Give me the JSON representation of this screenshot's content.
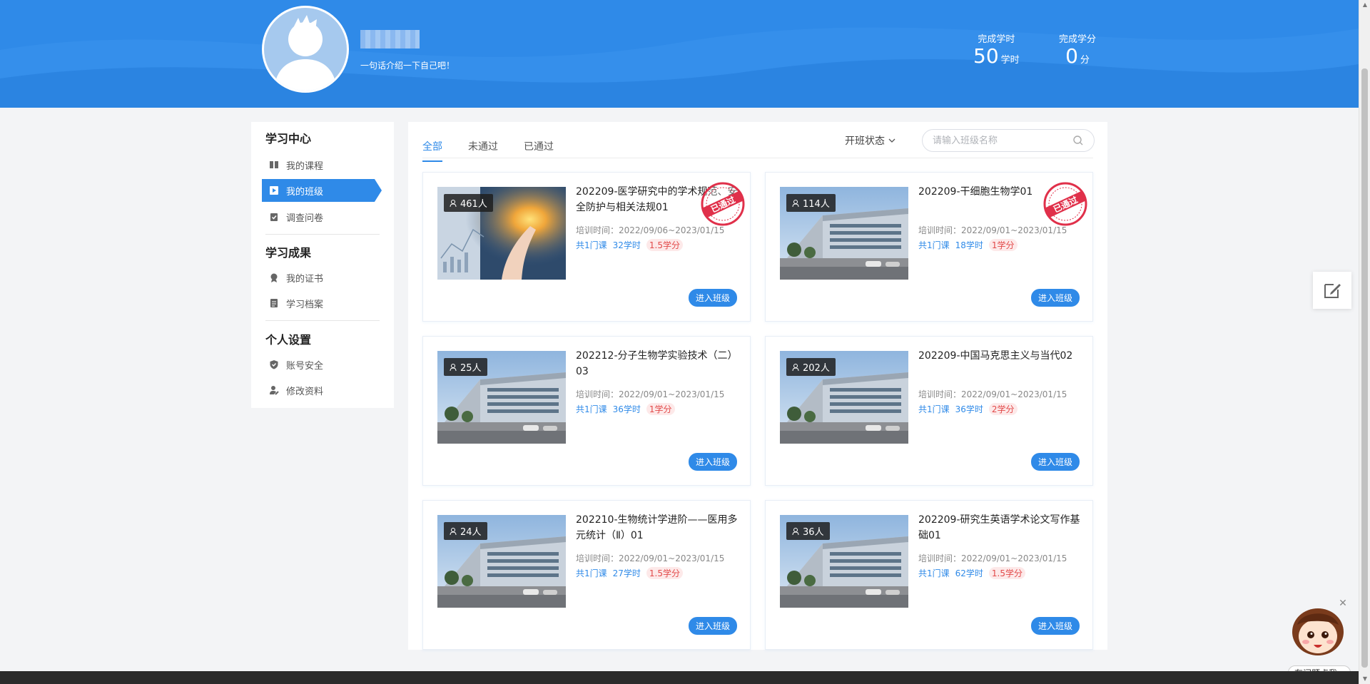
{
  "header": {
    "bio": "一句话介绍一下自己吧！",
    "stats": [
      {
        "label": "完成学时",
        "value": "50",
        "unit": "学时"
      },
      {
        "label": "完成学分",
        "value": "0",
        "unit": "分"
      }
    ],
    "background_color": "#2f8ae8"
  },
  "sidebar": {
    "sections": [
      {
        "title": "学习中心",
        "items": [
          {
            "label": "我的课程",
            "icon": "book-icon",
            "active": false
          },
          {
            "label": "我的班级",
            "icon": "class-icon",
            "active": true
          },
          {
            "label": "调查问卷",
            "icon": "clipboard-icon",
            "active": false
          }
        ]
      },
      {
        "title": "学习成果",
        "items": [
          {
            "label": "我的证书",
            "icon": "certificate-icon",
            "active": false
          },
          {
            "label": "学习档案",
            "icon": "file-icon",
            "active": false
          }
        ]
      },
      {
        "title": "个人设置",
        "items": [
          {
            "label": "账号安全",
            "icon": "shield-icon",
            "active": false
          },
          {
            "label": "修改资料",
            "icon": "user-edit-icon",
            "active": false
          }
        ]
      }
    ]
  },
  "main": {
    "tabs": [
      {
        "label": "全部",
        "active": true
      },
      {
        "label": "未通过",
        "active": false
      },
      {
        "label": "已通过",
        "active": false
      }
    ],
    "filter_label": "开班状态",
    "search_placeholder": "请输入班级名称",
    "enter_label": "进入班级",
    "stamp_text": "已通过",
    "cards": [
      {
        "count": "461人",
        "title": "202209-医学研究中的学术规范、安全防护与相关法规01",
        "time": "培训时间：2022/09/06~2023/01/15",
        "courses": "共1门课",
        "hours": "32学时",
        "credits": "1.5学分",
        "passed": true,
        "image": "tech"
      },
      {
        "count": "114人",
        "title": "202209-干细胞生物学01",
        "time": "培训时间：2022/09/01~2023/01/15",
        "courses": "共1门课",
        "hours": "18学时",
        "credits": "1学分",
        "passed": true,
        "image": "building"
      },
      {
        "count": "25人",
        "title": "202212-分子生物学实验技术（二）03",
        "time": "培训时间：2022/09/01~2023/01/15",
        "courses": "共1门课",
        "hours": "36学时",
        "credits": "1学分",
        "passed": false,
        "image": "building"
      },
      {
        "count": "202人",
        "title": "202209-中国马克思主义与当代02",
        "time": "培训时间：2022/09/01~2023/01/15",
        "courses": "共1门课",
        "hours": "36学时",
        "credits": "2学分",
        "passed": false,
        "image": "building"
      },
      {
        "count": "24人",
        "title": "202210-生物统计学进阶——医用多元统计（Ⅱ）01",
        "time": "培训时间：2022/09/01~2023/01/15",
        "courses": "共1门课",
        "hours": "27学时",
        "credits": "1.5学分",
        "passed": false,
        "image": "building"
      },
      {
        "count": "36人",
        "title": "202209-研究生英语学术论文写作基础01",
        "time": "培训时间：2022/09/01~2023/01/15",
        "courses": "共1门课",
        "hours": "62学时",
        "credits": "1.5学分",
        "passed": false,
        "image": "building"
      }
    ]
  },
  "floating": {
    "help_label": "有问题点我~",
    "close_symbol": "✕"
  }
}
